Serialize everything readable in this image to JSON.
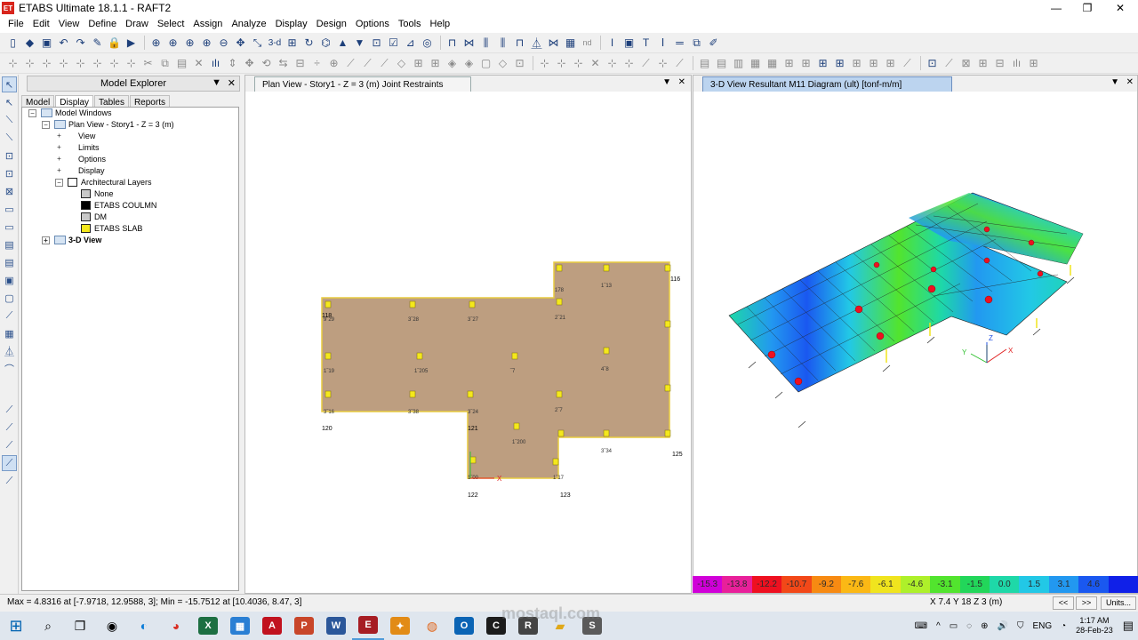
{
  "window": {
    "title": "ETABS Ultimate 18.1.1 - RAFT2",
    "app_icon": "ET",
    "minimize": "—",
    "maximize": "❐",
    "close": "✕"
  },
  "menu": [
    "File",
    "Edit",
    "View",
    "Define",
    "Draw",
    "Select",
    "Assign",
    "Analyze",
    "Display",
    "Design",
    "Options",
    "Tools",
    "Help"
  ],
  "toolbar": {
    "view3d_label": "3-d",
    "nd_label": "nd"
  },
  "explorer": {
    "title": "Model Explorer",
    "pin": "▼",
    "close": "✕",
    "tabs": [
      "Model",
      "Display",
      "Tables",
      "Reports"
    ],
    "active_tab": "Display",
    "tree": {
      "root": "Model Windows",
      "plan": "Plan View - Story1 - Z = 3 (m)",
      "view": "View",
      "limits": "Limits",
      "options": "Options",
      "display": "Display",
      "arch_layers": "Architectural Layers",
      "layer_none": "None",
      "layer_col": "ETABS COULMN",
      "layer_dm": "DM",
      "layer_slab": "ETABS SLAB",
      "view3d": "3-D View",
      "expand": "+",
      "collapse": "−"
    }
  },
  "plan_window": {
    "title": "Plan View - Story1 - Z = 3 (m)  Joint Restraints",
    "pin": "▼",
    "close": "✕",
    "labels": {
      "j116": "116",
      "j118": "118",
      "j120": "120",
      "j121": "121",
      "j122": "122",
      "j123": "123",
      "j125": "125",
      "axis_x": "X"
    }
  },
  "view3d_window": {
    "title": "3-D View    Resultant M11 Diagram    (ult)  [tonf-m/m]",
    "pin": "▼",
    "close": "✕",
    "axis_labels": {
      "x": "X",
      "y": "Y",
      "z": "Z"
    }
  },
  "legend": [
    {
      "value": "-15.3",
      "color": "#d000d8"
    },
    {
      "value": "-13.8",
      "color": "#e8209a"
    },
    {
      "value": "-12.2",
      "color": "#ee1020"
    },
    {
      "value": "-10.7",
      "color": "#f24818"
    },
    {
      "value": "-9.2",
      "color": "#f78a12"
    },
    {
      "value": "-7.6",
      "color": "#fbb815"
    },
    {
      "value": "-6.1",
      "color": "#f0e41e"
    },
    {
      "value": "-4.6",
      "color": "#aef02a"
    },
    {
      "value": "-3.1",
      "color": "#52e42e"
    },
    {
      "value": "-1.5",
      "color": "#22d65a"
    },
    {
      "value": "0.0",
      "color": "#1ed8a8"
    },
    {
      "value": "1.5",
      "color": "#22c8e6"
    },
    {
      "value": "3.1",
      "color": "#2298f0"
    },
    {
      "value": "4.6",
      "color": "#1a58f0"
    },
    {
      "value": "",
      "color": "#1020e8"
    }
  ],
  "status": {
    "left": "Max = 4.8316 at [-7.9718, 12.9588, 3];  Min = -15.7512 at [10.4036, 8.47, 3]",
    "coords": "X 7.4  Y 18  Z 3 (m)",
    "prev": "<<",
    "next": ">>",
    "units": "Units..."
  },
  "taskbar": {
    "start_icon": "⊞",
    "search_icon": "⌕",
    "lang": "ENG",
    "time": "1:17 AM",
    "date": "28-Feb-23"
  },
  "watermark": "mostaql.com"
}
